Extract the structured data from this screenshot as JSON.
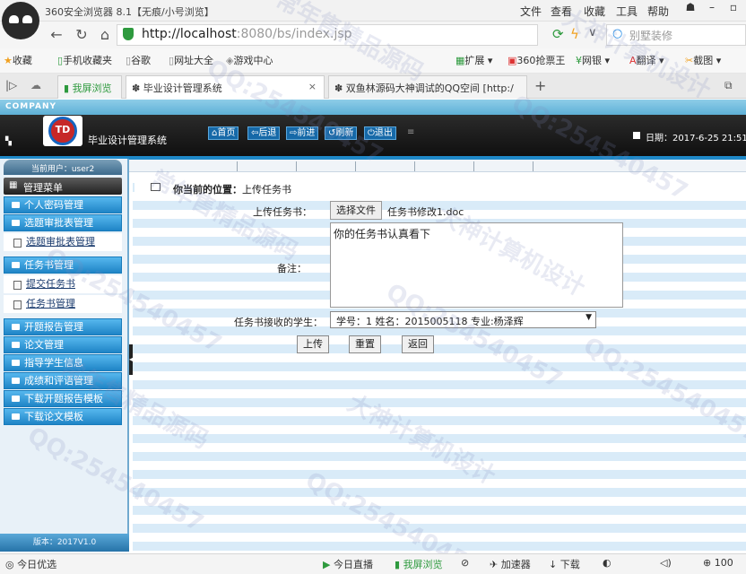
{
  "browser": {
    "window_title": "360安全浏览器 8.1【无痕/小号浏览】",
    "menu": [
      "文件",
      "查看",
      "收藏",
      "工具",
      "帮助"
    ],
    "url_host": "http://localhost",
    "url_rest": ":8080/bs/index.jsp",
    "search_placeholder": "别墅装修",
    "bookmarks": [
      "收藏",
      "手机收藏夹",
      "谷歌",
      "网址大全",
      "游戏中心",
      "扩展",
      "360抢票王",
      "网银",
      "翻译",
      "截图"
    ],
    "tabs": [
      {
        "label": "我屏浏览"
      },
      {
        "label": "毕业设计管理系统"
      },
      {
        "label": "双鱼林源码大神调试的QQ空间 [http:/"
      }
    ]
  },
  "site": {
    "company": "COMPANY",
    "logo_text": "TD",
    "system_title": "毕业设计管理系统",
    "toolbar": [
      "首页",
      "后退",
      "前进",
      "刷新",
      "退出"
    ],
    "date": "日期：2017-6-25 21:51"
  },
  "sidebar": {
    "current_user": "当前用户：user2",
    "menu_title": "管理菜单",
    "groups": [
      {
        "label": "个人密码管理"
      },
      {
        "label": "选题审批表管理",
        "items": [
          "选题审批表管理"
        ]
      },
      {
        "label": "任务书管理",
        "items": [
          "提交任务书",
          "任务书管理"
        ]
      },
      {
        "label": "开题报告管理"
      },
      {
        "label": "论文管理"
      },
      {
        "label": "指导学生信息"
      },
      {
        "label": "成绩和评语管理"
      },
      {
        "label": "下载开题报告模板"
      },
      {
        "label": "下载论文模板"
      }
    ],
    "version": "版本：2017V1.0"
  },
  "main": {
    "breadcrumb_prefix": "你当前的位置：",
    "breadcrumb_page": "上传任务书",
    "form": {
      "file_label": "上传任务书：",
      "file_button": "选择文件",
      "file_name": "任务书修改1.doc",
      "remark_label": "备注：",
      "remark_value": "你的任务书认真看下",
      "student_label": "任务书接收的学生：",
      "student_value": "学号：1    姓名：2015005118    专业:杨泽辉"
    },
    "buttons": {
      "upload": "上传",
      "reset": "重置",
      "back": "返回"
    }
  },
  "statusbar": [
    "今日优选",
    "今日直播",
    "我屏浏览",
    "加速器",
    "下载",
    "100"
  ],
  "watermarks": [
    "QQ:254540457",
    "大神计算机设计",
    "常年售精品源码"
  ]
}
